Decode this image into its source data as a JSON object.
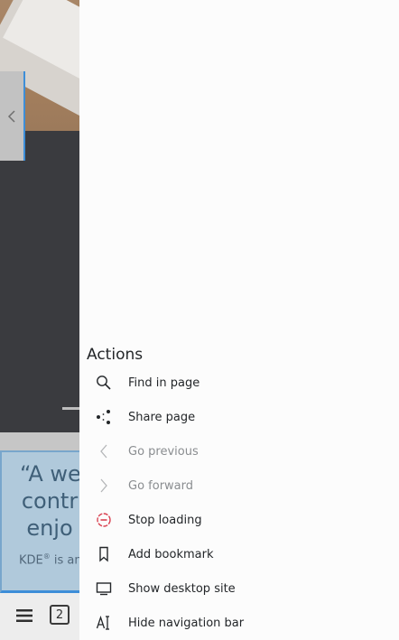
{
  "background_page": {
    "quote_text": "“A we\ncontr\nenjo",
    "kde_line": "KDE",
    "kde_line_rest": " is an",
    "registered_mark": "®",
    "tab_count": "2"
  },
  "drawer": {
    "heading": "Actions",
    "items": [
      {
        "label": "Find in page",
        "icon": "search-icon",
        "enabled": true
      },
      {
        "label": "Share page",
        "icon": "share-icon",
        "enabled": true
      },
      {
        "label": "Go previous",
        "icon": "chevron-left-icon",
        "enabled": false
      },
      {
        "label": "Go forward",
        "icon": "chevron-right-icon",
        "enabled": false
      },
      {
        "label": "Stop loading",
        "icon": "stop-icon",
        "enabled": true
      },
      {
        "label": "Add bookmark",
        "icon": "bookmark-icon",
        "enabled": true
      },
      {
        "label": "Show desktop site",
        "icon": "monitor-icon",
        "enabled": true
      },
      {
        "label": "Hide navigation bar",
        "icon": "text-cursor-icon",
        "enabled": true
      }
    ]
  },
  "colors": {
    "accent_blue": "#3d8ed8",
    "stop_red": "#da4453",
    "disabled_text": "#8a8d90"
  }
}
